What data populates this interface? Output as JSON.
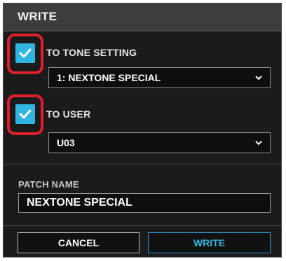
{
  "dialog": {
    "title": "WRITE"
  },
  "options": [
    {
      "label": "TO TONE SETTING",
      "checked": true,
      "select_value": "1: NEXTONE SPECIAL"
    },
    {
      "label": "TO USER",
      "checked": true,
      "select_value": "U03"
    }
  ],
  "patch_name": {
    "label": "PATCH NAME",
    "value": "NEXTONE SPECIAL"
  },
  "buttons": {
    "cancel": "CANCEL",
    "write": "WRITE"
  },
  "colors": {
    "accent": "#2fb6e0",
    "highlight": "#e0202a",
    "background": "#1b1b1b",
    "titlebar": "#3c3c3c"
  },
  "icons": {
    "checkbox": "check-icon",
    "dropdown": "chevron-down-icon"
  }
}
